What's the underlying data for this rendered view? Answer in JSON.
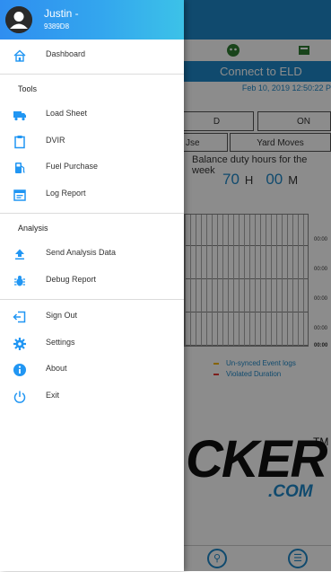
{
  "user": {
    "name": "Justin -",
    "id": "9389D8"
  },
  "menu_main": [
    {
      "label": "Dashboard",
      "icon": "home-icon"
    }
  ],
  "sections": [
    {
      "title": "Tools",
      "items": [
        {
          "label": "Load Sheet",
          "icon": "truck-icon"
        },
        {
          "label": "DVIR",
          "icon": "clipboard-icon"
        },
        {
          "label": "Fuel Purchase",
          "icon": "fuel-icon"
        },
        {
          "label": "Log Report",
          "icon": "calendar-icon"
        }
      ]
    },
    {
      "title": "Analysis",
      "items": [
        {
          "label": "Send Analysis Data",
          "icon": "upload-icon"
        },
        {
          "label": "Debug Report",
          "icon": "bug-icon"
        }
      ]
    }
  ],
  "menu_bottom": [
    {
      "label": "Sign Out",
      "icon": "sign-out-icon"
    },
    {
      "label": "Settings",
      "icon": "gear-icon"
    },
    {
      "label": "About",
      "icon": "info-icon"
    },
    {
      "label": "Exit",
      "icon": "power-icon"
    }
  ],
  "background": {
    "connect_label": "Connect to ELD",
    "date": "Feb 10, 2019 12:50:22 P",
    "status_d": "D",
    "status_on": "ON",
    "btn_use": "Jse",
    "btn_yard": "Yard Moves",
    "balance_title": "Balance duty hours for the week",
    "hours_value": "70",
    "hours_unit": "H",
    "minutes_value": "00",
    "minutes_unit": "M",
    "grid_labels": [
      "00:00",
      "00:00",
      "00:00",
      "00:00",
      "00:00"
    ],
    "legend_unsynced": "Un-synced Event logs",
    "legend_violated": "Violated Duration",
    "logo_text": "CKER",
    "logo_tm": "TM",
    "logo_com": ".COM"
  },
  "colors": {
    "accent": "#1e88c8",
    "header_gradient_start": "#2f8ef0",
    "header_gradient_end": "#3cc2e8",
    "icon_blue": "#2196f3"
  }
}
